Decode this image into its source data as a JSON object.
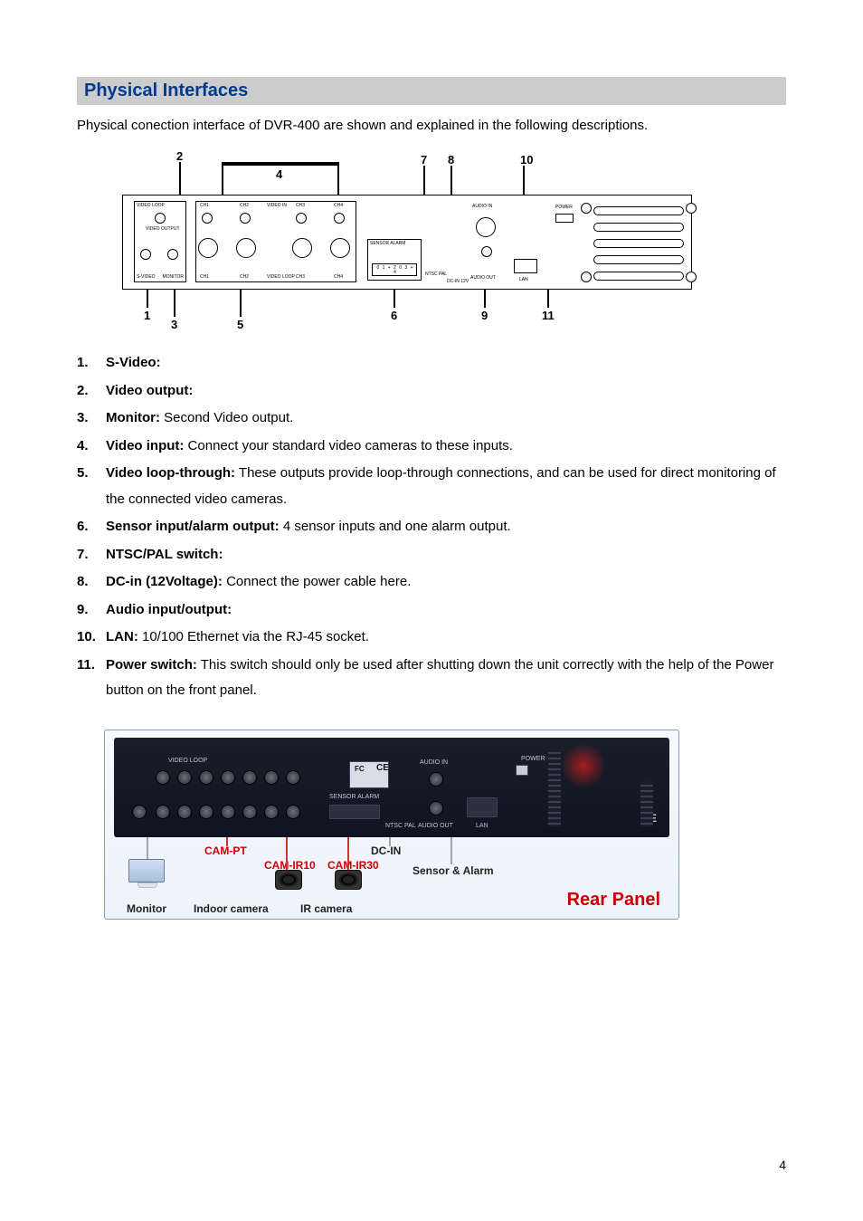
{
  "heading": "Physical Interfaces",
  "intro": "Physical conection interface of DVR-400 are shown and explained in the following descriptions.",
  "diagram": {
    "callouts_top": [
      "2",
      "4",
      "7",
      "8",
      "10"
    ],
    "callouts_bottom": [
      "1",
      "3",
      "5",
      "6",
      "9",
      "11"
    ],
    "panel_labels": {
      "video_loop": "VIDEO LOOP",
      "video_output": "VIDEO OUTPUT",
      "video_in": "VIDEO IN",
      "video_loop2": "VIDEO LOOP",
      "svideo": "S-VIDEO",
      "monitor": "MONITOR",
      "ch": [
        "CH1",
        "CH2",
        "CH3",
        "CH4"
      ],
      "sensor_alarm": "SENSOR    ALARM",
      "sensor_pins": "0 1 + 2 0 3 + 4",
      "ntsc_pal": "NTSC PAL",
      "dcin": "DC-IN 12V",
      "audio_in": "AUDIO IN",
      "audio_out": "AUDIO OUT",
      "lan": "LAN",
      "power": "POWER"
    }
  },
  "items": [
    {
      "term": "S-Video:",
      "desc": ""
    },
    {
      "term": "Video output:",
      "desc": ""
    },
    {
      "term": "Monitor:",
      "desc": " Second Video output."
    },
    {
      "term": "Video input:",
      "desc": " Connect your standard video cameras to these inputs."
    },
    {
      "term": "Video loop-through:",
      "desc": " These outputs provide loop-through connections, and can be used for direct monitoring of the connected video cameras."
    },
    {
      "term": "Sensor input/alarm output:",
      "desc": " 4 sensor inputs and one alarm output."
    },
    {
      "term": "NTSC/PAL switch:",
      "desc": ""
    },
    {
      "term": "DC-in (12Voltage):",
      "desc": " Connect the power cable here."
    },
    {
      "term": "Audio input/output:",
      "desc": ""
    },
    {
      "term": "LAN:",
      "desc": " 10/100 Ethernet via the RJ-45 socket."
    },
    {
      "term": "Power switch:",
      "desc": " This switch should only be used after shutting down the unit correctly with the help of the Power button on the front panel."
    }
  ],
  "photo": {
    "cam_pt": "CAM-PT",
    "cam_ir10": "CAM-IR10",
    "cam_ir30": "CAM-IR30",
    "dcin": "DC-IN",
    "sensor_alarm": "Sensor & Alarm",
    "monitor": "Monitor",
    "indoor": "Indoor camera",
    "ircam": "IR camera",
    "rear_panel": "Rear Panel",
    "device_text": {
      "video_loop": "VIDEO LOOP",
      "audio_in": "AUDIO IN",
      "power": "POWER",
      "sensor": "SENSOR    ALARM",
      "ntsc": "NTSC PAL",
      "audio_out": "AUDIO OUT",
      "lan": "LAN",
      "fc": "FC",
      "ce": "CE",
      "ce2": "CE"
    }
  },
  "page_number": "4"
}
